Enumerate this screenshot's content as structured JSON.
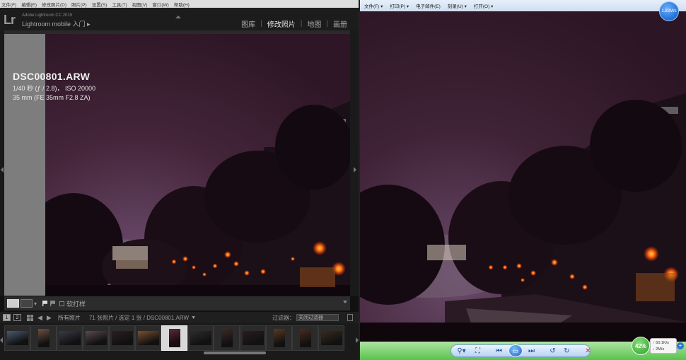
{
  "lightroom": {
    "menu": [
      "文件(F)",
      "编辑(E)",
      "修改照片(D)",
      "照片(P)",
      "设置(S)",
      "工具(T)",
      "视图(V)",
      "窗口(W)",
      "帮助(H)"
    ],
    "logo": "Lr",
    "version": "Adobe Lightroom CC 2015",
    "mobile_label": "Lightroom mobile 入门 ▸",
    "modules": [
      {
        "label": "图库",
        "active": false
      },
      {
        "label": "修改照片",
        "active": true
      },
      {
        "label": "地图",
        "active": false
      },
      {
        "label": "画册",
        "active": false
      }
    ],
    "photo_info": {
      "filename": "DSC00801.ARW",
      "exposure": "1/40 秒 (ƒ / 2.8)， ISO 20000",
      "lens": "35 mm (FE 35mm F2.8 ZA)"
    },
    "toolbar": {
      "dropdown": "▾",
      "softproof_label": "软打样"
    },
    "filmstrip_bar": {
      "pages": [
        "1",
        "2"
      ],
      "source": "所有照片",
      "count": "71 张照片 / 选定 1 张 / DSC00801.ARW",
      "filter_label": "过滤器：",
      "filter_value": "关闭过滤器"
    },
    "thumbnail_count": 13,
    "selected_thumbnail": 6
  },
  "photo_viewer": {
    "menu": [
      "文件(F) ▾",
      "打印(P) ▾",
      "电子邮件(E)",
      "刻录(U) ▾",
      "打开(O) ▾"
    ],
    "badge": "1.83M/s",
    "controls": {
      "zoom": "⚲▾",
      "fit": "⛶",
      "prev": "⏮",
      "slideshow": "▭",
      "next": "⏭",
      "rotate_ccw": "↺",
      "rotate_cw": "↻",
      "delete": "✕"
    },
    "zoom_percent": "42%",
    "net_up": "↑  50.1K/s",
    "net_down": "↓  2M/s",
    "plus": "+"
  },
  "colors": {
    "sky": "#3d2030",
    "lantern": "#ff7a10",
    "lr_bg": "#111111",
    "viewer_green": "#59c34c",
    "viewer_blue": "#1f6fd6"
  }
}
